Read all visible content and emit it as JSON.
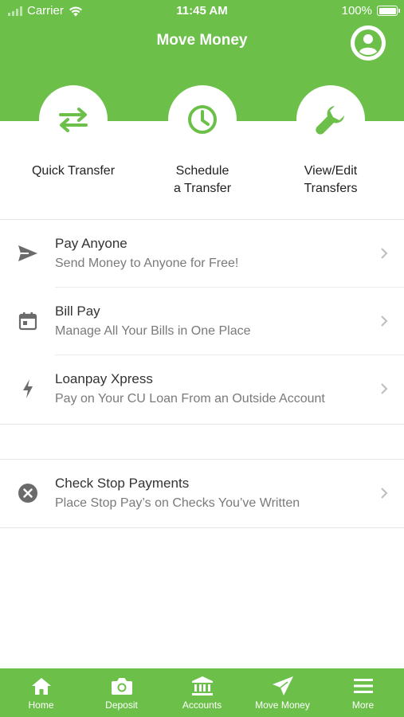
{
  "status_bar": {
    "carrier": "Carrier",
    "time": "11:45 AM",
    "battery": "100%"
  },
  "header": {
    "title": "Move Money"
  },
  "actions": [
    {
      "label": "Quick Transfer",
      "icon": "swap-arrows-icon"
    },
    {
      "label": "Schedule\na Transfer",
      "icon": "clock-icon"
    },
    {
      "label": "View/Edit\nTransfers",
      "icon": "wrench-icon"
    }
  ],
  "menu": [
    {
      "title": "Pay Anyone",
      "subtitle": "Send Money to Anyone for Free!",
      "icon": "send-icon"
    },
    {
      "title": "Bill Pay",
      "subtitle": "Manage All Your Bills in One Place",
      "icon": "calendar-icon"
    },
    {
      "title": "Loanpay Xpress",
      "subtitle": "Pay on Your CU Loan From an Outside Account",
      "icon": "lightning-icon"
    }
  ],
  "menu2": [
    {
      "title": "Check Stop Payments",
      "subtitle": "Place Stop Pay’s on Checks You’ve Written",
      "icon": "cancel-circle-icon"
    }
  ],
  "tabs": [
    {
      "label": "Home",
      "icon": "home-icon"
    },
    {
      "label": "Deposit",
      "icon": "camera-icon"
    },
    {
      "label": "Accounts",
      "icon": "bank-icon"
    },
    {
      "label": "Move Money",
      "icon": "send-icon",
      "selected": true
    },
    {
      "label": "More",
      "icon": "menu-icon"
    }
  ],
  "colors": {
    "brand_green": "#6cc04a",
    "text_dark": "#333333",
    "text_muted": "#7a7a7a",
    "icon_gray": "#6b6b6b"
  }
}
